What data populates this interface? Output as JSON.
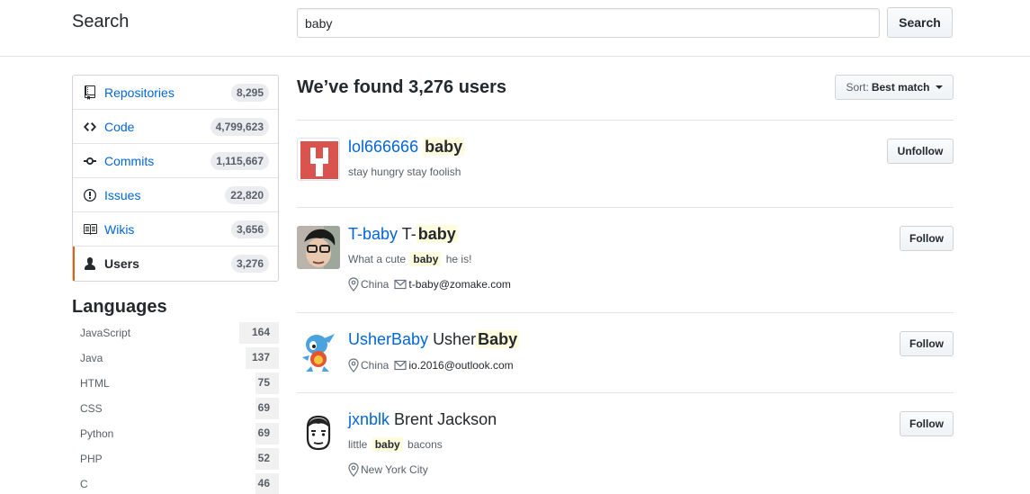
{
  "header": {
    "title": "Search",
    "search_value": "baby",
    "search_button": "Search"
  },
  "sidebar": {
    "items": [
      {
        "label": "Repositories",
        "count": "8,295",
        "icon": "repo-icon"
      },
      {
        "label": "Code",
        "count": "4,799,623",
        "icon": "code-icon"
      },
      {
        "label": "Commits",
        "count": "1,115,667",
        "icon": "commit-icon"
      },
      {
        "label": "Issues",
        "count": "22,820",
        "icon": "issue-icon"
      },
      {
        "label": "Wikis",
        "count": "3,656",
        "icon": "book-icon"
      },
      {
        "label": "Users",
        "count": "3,276",
        "icon": "person-icon",
        "selected": true
      }
    ]
  },
  "languages": {
    "title": "Languages",
    "items": [
      {
        "name": "JavaScript",
        "count": "164"
      },
      {
        "name": "Java",
        "count": "137"
      },
      {
        "name": "HTML",
        "count": "75"
      },
      {
        "name": "CSS",
        "count": "69"
      },
      {
        "name": "Python",
        "count": "69"
      },
      {
        "name": "PHP",
        "count": "52"
      },
      {
        "name": "C",
        "count": "46"
      }
    ]
  },
  "results": {
    "title": "We’ve found 3,276 users",
    "sort_prefix": "Sort:",
    "sort_value": "Best match"
  },
  "users": [
    {
      "login": "lol666666",
      "name_prefix": "",
      "name_highlight": "baby",
      "bio_before": "stay hungry stay foolish",
      "bio_highlight": "",
      "bio_after": "",
      "location": "",
      "email": "",
      "button": "Unfollow"
    },
    {
      "login": "T-baby",
      "name_prefix": "T-",
      "name_highlight": "baby",
      "bio_before": "What a cute",
      "bio_highlight": "baby",
      "bio_after": "he is!",
      "location": "China",
      "email": "t-baby@zomake.com",
      "button": "Follow"
    },
    {
      "login": "UsherBaby",
      "name_prefix": "Usher",
      "name_highlight": "Baby",
      "bio_before": "",
      "bio_highlight": "",
      "bio_after": "",
      "location": "China",
      "email": "io.2016@outlook.com",
      "button": "Follow"
    },
    {
      "login": "jxnblk",
      "name_prefix": "Brent Jackson",
      "name_highlight": "",
      "bio_before": "little",
      "bio_highlight": "baby",
      "bio_after": "bacons",
      "location": "New York City",
      "email": "",
      "button": "Follow"
    }
  ],
  "colors": {
    "link": "#0366d6",
    "highlight": "#fffbdd",
    "selected_accent": "#e36209"
  }
}
